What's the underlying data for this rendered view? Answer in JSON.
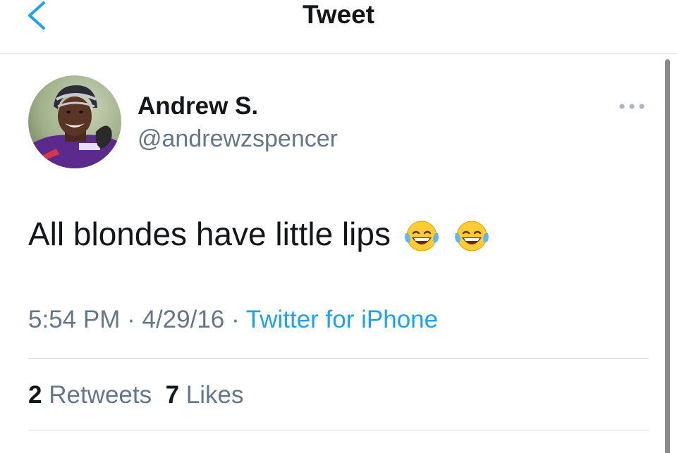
{
  "header": {
    "title": "Tweet",
    "back_icon": "chevron-left-icon"
  },
  "colors": {
    "accent": "#1da1f2",
    "secondary_text": "#657786",
    "primary_text": "#14171a"
  },
  "tweet": {
    "author_name": "Andrew S.",
    "author_handle": "@andrewzspencer",
    "text": "All blondes have little lips",
    "emojis": [
      "face-with-tears-of-joy-icon",
      "face-with-tears-of-joy-icon"
    ],
    "time": "5:54 PM",
    "date": "4/29/16",
    "source": "Twitter for iPhone",
    "separator": "·",
    "more_icon": "more-dots-icon"
  },
  "stats": {
    "retweets_count": "2",
    "retweets_label": "Retweets",
    "likes_count": "7",
    "likes_label": "Likes"
  }
}
